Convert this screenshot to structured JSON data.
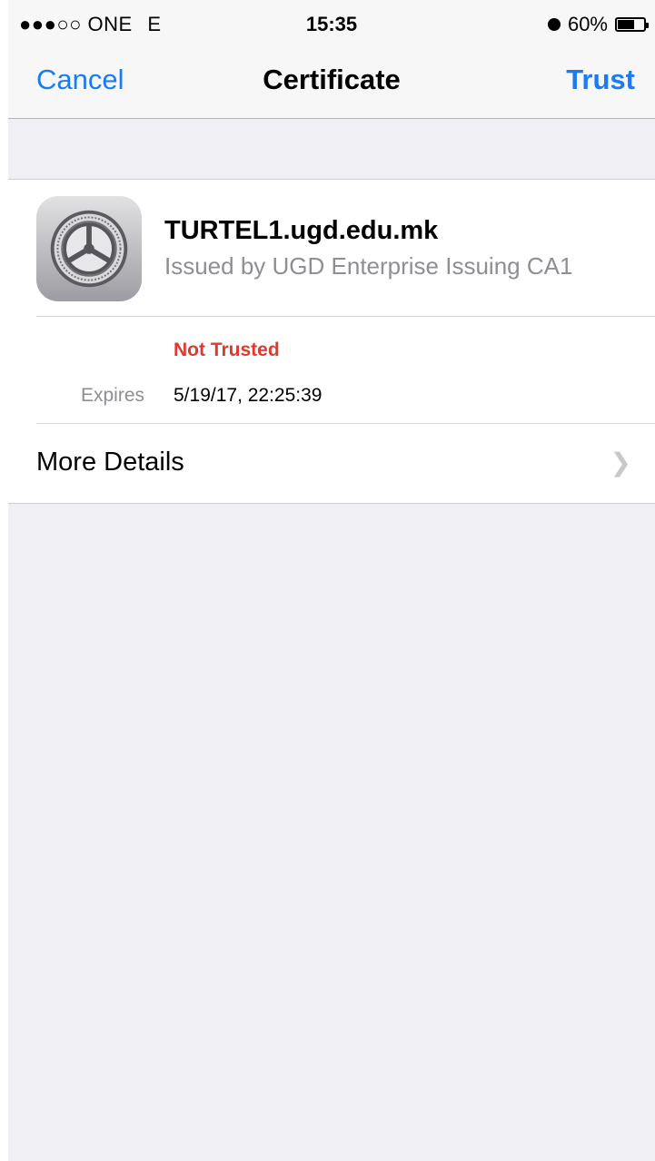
{
  "status_bar": {
    "carrier": "●●●○○ ONE",
    "network": "E",
    "time": "15:35",
    "battery": "60%"
  },
  "nav": {
    "cancel_label": "Cancel",
    "title": "Certificate",
    "trust_label": "Trust"
  },
  "certificate": {
    "icon": "settings-gear-icon",
    "name": "TURTEL1.ugd.edu.mk",
    "issuer": "Issued by UGD Enterprise Issuing CA1",
    "status": "Not Trusted",
    "expires_label": "Expires",
    "expires_value": "5/19/17, 22:25:39"
  },
  "more_details": {
    "label": "More Details",
    "icon": "chevron-right-icon"
  },
  "colors": {
    "accent": "#1a7cf5",
    "danger": "#e0392e",
    "secondary_text": "#8e8e93",
    "background": "#efeff4"
  }
}
